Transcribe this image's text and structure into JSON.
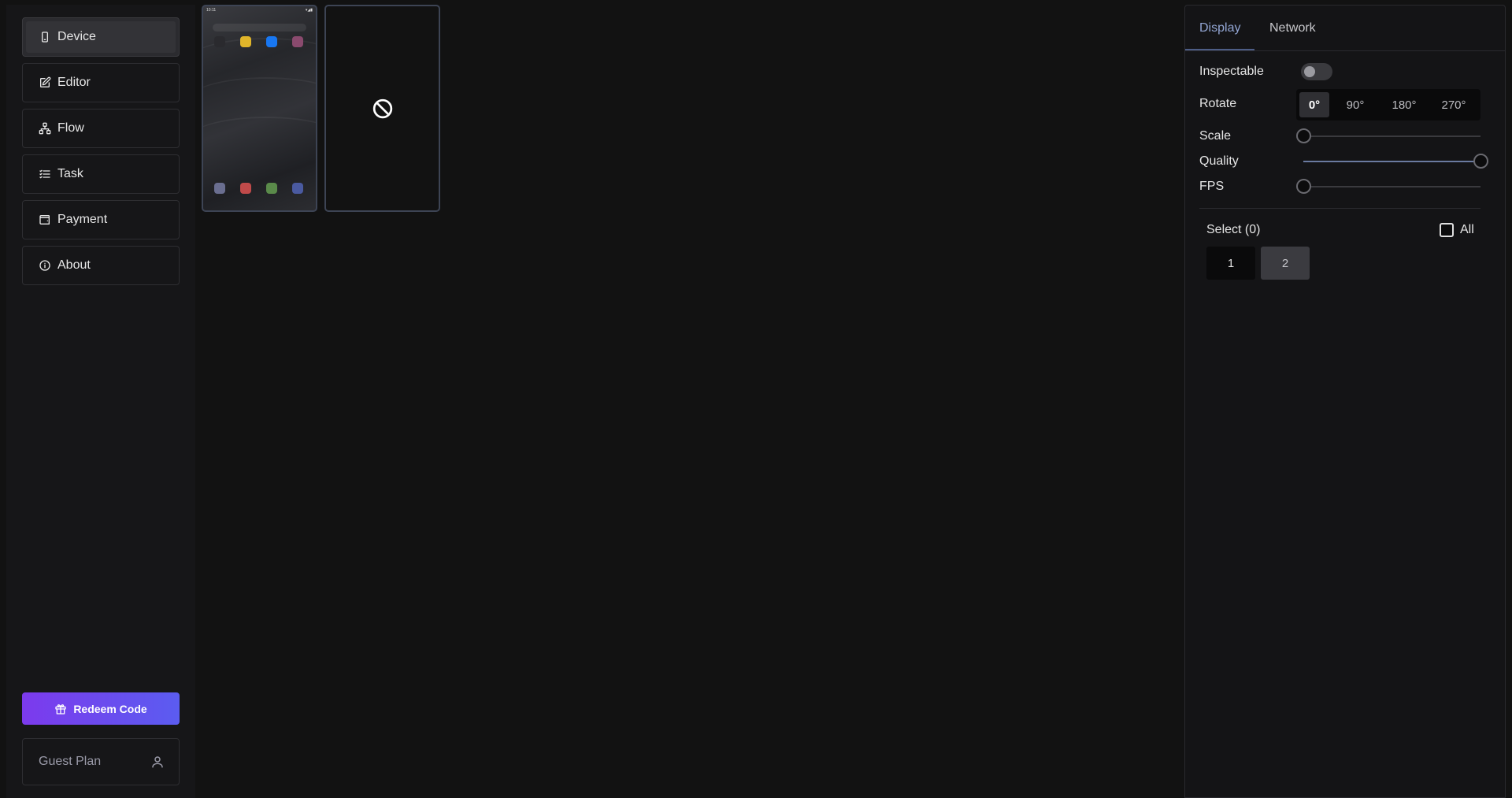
{
  "sidebar": {
    "items": [
      {
        "label": "Device",
        "icon": "device-icon"
      },
      {
        "label": "Editor",
        "icon": "edit-icon"
      },
      {
        "label": "Flow",
        "icon": "flow-icon"
      },
      {
        "label": "Task",
        "icon": "task-list-icon"
      },
      {
        "label": "Payment",
        "icon": "wallet-icon"
      },
      {
        "label": "About",
        "icon": "info-icon"
      }
    ],
    "redeem_label": "Redeem Code",
    "plan_label": "Guest Plan"
  },
  "devices": [
    {
      "status": "online",
      "time": "10:11"
    },
    {
      "status": "disconnected"
    }
  ],
  "panel": {
    "tabs": [
      "Display",
      "Network"
    ],
    "active_tab": "Display",
    "inspectable_label": "Inspectable",
    "inspectable": false,
    "rotate_label": "Rotate",
    "rotate_options": [
      "0°",
      "90°",
      "180°",
      "270°"
    ],
    "rotate_selected": "0°",
    "scale_label": "Scale",
    "scale_value": 0,
    "quality_label": "Quality",
    "quality_value": 1,
    "fps_label": "FPS",
    "fps_value": 0,
    "select_label": "Select (0)",
    "all_label": "All",
    "select_buttons": [
      "1",
      "2"
    ]
  },
  "colors": {
    "background": "#121212",
    "accent": "#93a6d4",
    "redeem_gradient_start": "#7c3aed",
    "redeem_gradient_end": "#5b5cf0"
  }
}
